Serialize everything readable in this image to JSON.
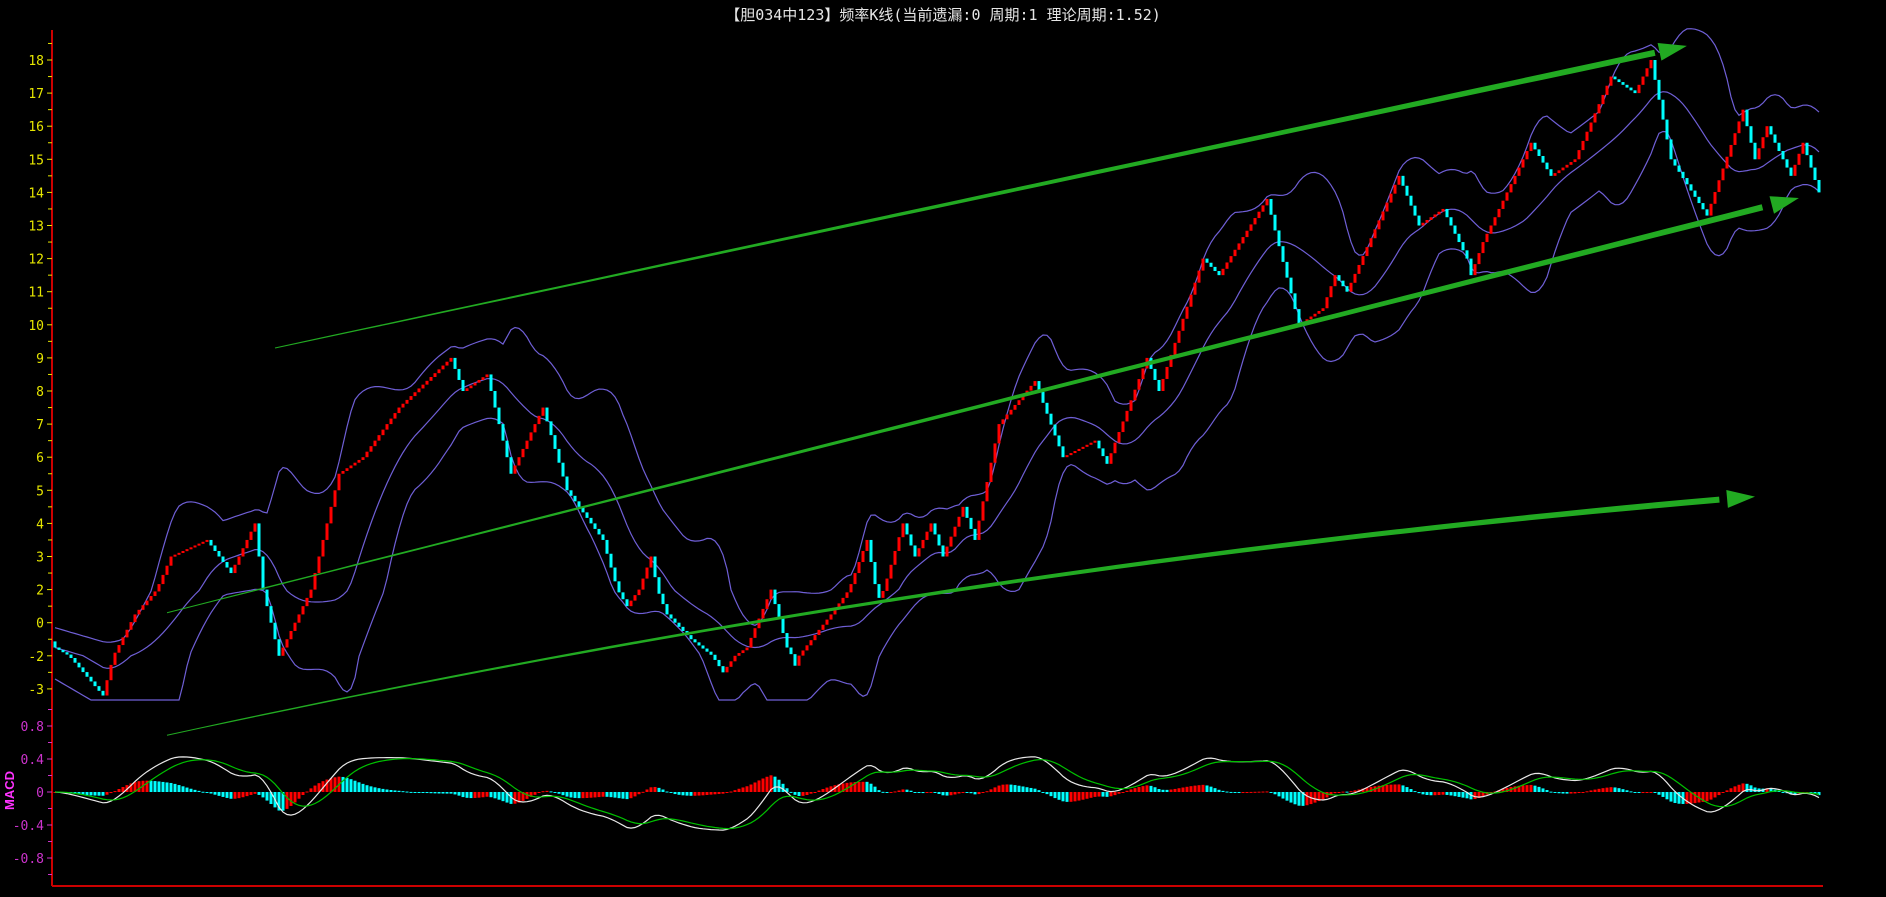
{
  "chart_data": {
    "type": "candlestick",
    "title": "【胆034中123】频率K线(当前遗漏:0 周期:1 理论周期:1.52)",
    "y_tick_labels": [
      "18",
      "17",
      "16",
      "15",
      "14",
      "13",
      "12",
      "11",
      "10",
      "9",
      "8",
      "7",
      "6",
      "5",
      "4",
      "3",
      "2",
      "0",
      "-2",
      "-3"
    ],
    "y_tick_values": [
      18,
      17,
      16,
      15,
      14,
      13,
      12,
      11,
      10,
      9,
      8,
      7,
      6,
      5,
      4,
      3,
      2,
      0,
      -2,
      -3
    ],
    "close_keypoints": [
      [
        0,
        -1.5
      ],
      [
        12,
        -3.2
      ],
      [
        20,
        0.5
      ],
      [
        29,
        3
      ],
      [
        38,
        3.5
      ],
      [
        44,
        2.5
      ],
      [
        50,
        4
      ],
      [
        56,
        -2
      ],
      [
        71,
        5.5
      ],
      [
        77,
        6
      ],
      [
        86,
        7.5
      ],
      [
        99,
        9
      ],
      [
        102,
        8
      ],
      [
        108,
        8.5
      ],
      [
        114,
        5.5
      ],
      [
        122,
        7.5
      ],
      [
        128,
        5
      ],
      [
        137,
        3.5
      ],
      [
        143,
        1
      ],
      [
        149,
        3
      ],
      [
        153,
        0.5
      ],
      [
        159,
        -1
      ],
      [
        167,
        -2.5
      ],
      [
        173,
        -1.5
      ],
      [
        179,
        2
      ],
      [
        183,
        -1.5
      ],
      [
        185,
        -2.3
      ],
      [
        194,
        0.5
      ],
      [
        203,
        3.5
      ],
      [
        206,
        1.5
      ],
      [
        212,
        4
      ],
      [
        215,
        3
      ],
      [
        219,
        4
      ],
      [
        222,
        3
      ],
      [
        227,
        4.5
      ],
      [
        230,
        3.5
      ],
      [
        236,
        7
      ],
      [
        245,
        8.3
      ],
      [
        252,
        6
      ],
      [
        260,
        6.5
      ],
      [
        263,
        5.8
      ],
      [
        273,
        9
      ],
      [
        276,
        8
      ],
      [
        287,
        12
      ],
      [
        291,
        11.5
      ],
      [
        303,
        13.8
      ],
      [
        311,
        10
      ],
      [
        317,
        10.5
      ],
      [
        320,
        11.5
      ],
      [
        323,
        11
      ],
      [
        336,
        14.5
      ],
      [
        341,
        13
      ],
      [
        347,
        13.5
      ],
      [
        353,
        12
      ],
      [
        354,
        11.5
      ],
      [
        357,
        12.5
      ],
      [
        365,
        14.5
      ],
      [
        369,
        15.5
      ],
      [
        374,
        14.5
      ],
      [
        380,
        15
      ],
      [
        389,
        17.5
      ],
      [
        395,
        17
      ],
      [
        399,
        18
      ],
      [
        404,
        15
      ],
      [
        413,
        13.3
      ],
      [
        422,
        16.5
      ],
      [
        425,
        15
      ],
      [
        428,
        16
      ],
      [
        434,
        14.5
      ],
      [
        437,
        15.5
      ],
      [
        441,
        14
      ]
    ],
    "bollinger": {
      "period": 20,
      "k": 2
    },
    "macd": {
      "label": "MACD",
      "fast": 12,
      "slow": 26,
      "signal": 9,
      "y_tick_labels": [
        "0.8",
        "0.4",
        "0",
        "-0.4",
        "-0.8"
      ],
      "y_tick_values": [
        0.8,
        0.4,
        0,
        -0.4,
        -0.8
      ],
      "ylim": [
        -1.1,
        1.1
      ]
    },
    "trend_arrows": [
      {
        "from": [
          55,
          9.3
        ],
        "to": [
          407,
          18.4
        ]
      },
      {
        "from": [
          28,
          0.6
        ],
        "to": [
          435,
          13.8
        ]
      },
      {
        "from": [
          28,
          -4.4
        ],
        "via": [
          226,
          2.0
        ],
        "to": [
          424,
          4.8
        ]
      }
    ],
    "colors": {
      "up": "#ff0000",
      "down": "#00ffff",
      "bands": "#6f5fd6",
      "dif": "#e8e8e8",
      "dea": "#00c000",
      "arrow": "#22aa22",
      "axis": "#cc0000",
      "price_label": "#e6e600",
      "macd_label": "#cc33cc",
      "title": "#e6e6e6"
    }
  }
}
